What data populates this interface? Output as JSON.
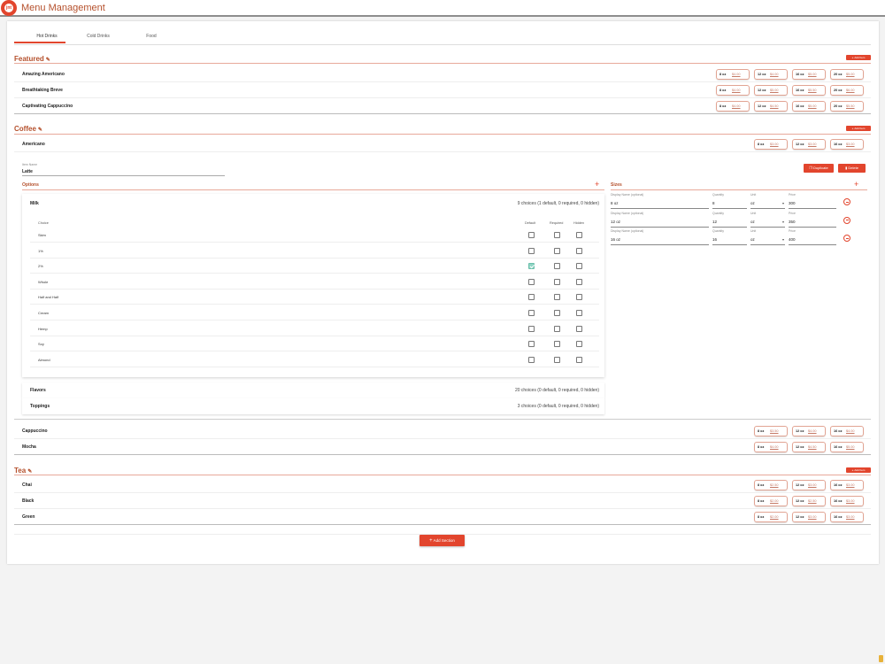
{
  "app": {
    "title": "Menu Management",
    "logo_text": "jnt"
  },
  "tabs": [
    {
      "label": "Hot Drinks"
    },
    {
      "label": "Cold Drinks"
    },
    {
      "label": "Food"
    }
  ],
  "common": {
    "add_item": "Add Item",
    "add_section": "Add Section",
    "pencil": "✎",
    "plus": "+",
    "minus": "−"
  },
  "sections": {
    "featured": {
      "title": "Featured",
      "items": [
        {
          "name": "Amazing Americano",
          "sizes": [
            {
              "size": "8 oz",
              "price": "$4.00"
            },
            {
              "size": "12 oz",
              "price": "$4.00"
            },
            {
              "size": "16 oz",
              "price": "$5.00"
            },
            {
              "size": "20 oz",
              "price": "$5.00"
            }
          ]
        },
        {
          "name": "Breathtaking Breve",
          "sizes": [
            {
              "size": "8 oz",
              "price": "$4.00"
            },
            {
              "size": "12 oz",
              "price": "$5.00"
            },
            {
              "size": "16 oz",
              "price": "$5.50"
            },
            {
              "size": "20 oz",
              "price": "$6.00"
            }
          ]
        },
        {
          "name": "Captivating Cappuccino",
          "sizes": [
            {
              "size": "8 oz",
              "price": "$4.00"
            },
            {
              "size": "12 oz",
              "price": "$4.50"
            },
            {
              "size": "16 oz",
              "price": "$5.00"
            },
            {
              "size": "20 oz",
              "price": "$5.50"
            }
          ]
        }
      ]
    },
    "coffee": {
      "title": "Coffee",
      "items": [
        {
          "name": "Americano",
          "sizes": [
            {
              "size": "8 oz",
              "price": "$3.00"
            },
            {
              "size": "12 oz",
              "price": "$3.00"
            },
            {
              "size": "16 oz",
              "price": "$3.00"
            }
          ]
        },
        {
          "name": "Cappuccino",
          "sizes": [
            {
              "size": "8 oz",
              "price": "$3.50"
            },
            {
              "size": "12 oz",
              "price": "$4.00"
            },
            {
              "size": "16 oz",
              "price": "$4.00"
            }
          ]
        },
        {
          "name": "Mocha",
          "sizes": [
            {
              "size": "8 oz",
              "price": "$4.00"
            },
            {
              "size": "12 oz",
              "price": "$4.50"
            },
            {
              "size": "16 oz",
              "price": "$5.00"
            }
          ]
        }
      ]
    },
    "tea": {
      "title": "Tea",
      "items": [
        {
          "name": "Chai",
          "sizes": [
            {
              "size": "8 oz",
              "price": "$2.50"
            },
            {
              "size": "12 oz",
              "price": "$3.00"
            },
            {
              "size": "16 oz",
              "price": "$3.00"
            }
          ]
        },
        {
          "name": "Black",
          "sizes": [
            {
              "size": "8 oz",
              "price": "$2.00"
            },
            {
              "size": "12 oz",
              "price": "$2.50"
            },
            {
              "size": "16 oz",
              "price": "$3.00"
            }
          ]
        },
        {
          "name": "Green",
          "sizes": [
            {
              "size": "8 oz",
              "price": "$2.00"
            },
            {
              "size": "12 oz",
              "price": "$3.00"
            },
            {
              "size": "16 oz",
              "price": "$3.00"
            }
          ]
        }
      ]
    }
  },
  "editor": {
    "item_name_label": "Item Name",
    "item_name_value": "Latte",
    "duplicate_label": "Duplicate",
    "delete_label": "Delete",
    "options_title": "Options",
    "sizes_title": "Sizes",
    "option_groups": [
      {
        "title": "Milk",
        "summary": "9 choices (1 default, 0 required, 0 hidden)",
        "columns": {
          "choice": "Choice",
          "default": "Default",
          "required": "Required",
          "hidden": "Hidden"
        },
        "choices": [
          {
            "name": "Skim",
            "default": false,
            "required": false,
            "hidden": false
          },
          {
            "name": "1%",
            "default": false,
            "required": false,
            "hidden": false
          },
          {
            "name": "2%",
            "default": true,
            "required": false,
            "hidden": false
          },
          {
            "name": "Whole",
            "default": false,
            "required": false,
            "hidden": false
          },
          {
            "name": "Half and Half",
            "default": false,
            "required": false,
            "hidden": false
          },
          {
            "name": "Cream",
            "default": false,
            "required": false,
            "hidden": false
          },
          {
            "name": "Hemp",
            "default": false,
            "required": false,
            "hidden": false
          },
          {
            "name": "Soy",
            "default": false,
            "required": false,
            "hidden": false
          },
          {
            "name": "Almond",
            "default": false,
            "required": false,
            "hidden": false
          }
        ]
      },
      {
        "title": "Flavors",
        "summary": "20 choices (0 default, 0 required, 0 hidden)"
      },
      {
        "title": "Toppings",
        "summary": "3 choices (0 default, 0 required, 0 hidden)"
      }
    ],
    "size_labels": {
      "display_name": "Display Name (optional)",
      "quantity": "Quantity",
      "unit": "Unit",
      "price": "Price"
    },
    "sizes": [
      {
        "display_name": "8 oz",
        "quantity": "8",
        "unit": "oz",
        "price": "300"
      },
      {
        "display_name": "12 oz",
        "quantity": "12",
        "unit": "oz",
        "price": "350"
      },
      {
        "display_name": "16 oz",
        "quantity": "16",
        "unit": "oz",
        "price": "400"
      }
    ]
  },
  "colors": {
    "accent": "#e2452d",
    "heading": "#b5502c",
    "checked": "#8fd4c4"
  }
}
